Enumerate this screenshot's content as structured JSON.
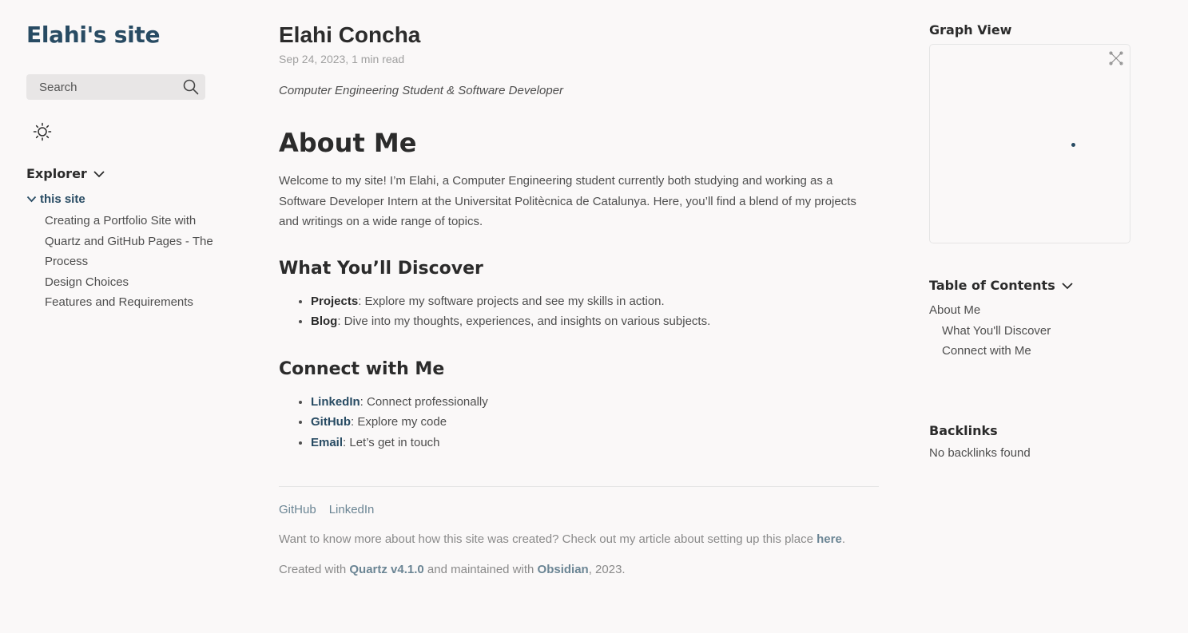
{
  "sidebar": {
    "site_title": "Elahi's site",
    "search_placeholder": "Search",
    "explorer_label": "Explorer",
    "folder_label": "this site",
    "files": [
      "Creating a Portfolio Site with Quartz and GitHub Pages - The Process",
      "Design Choices",
      "Features and Requirements"
    ]
  },
  "article": {
    "title": "Elahi Concha",
    "meta": "Sep 24, 2023, 1 min read",
    "subtitle": "Computer Engineering Student & Software Developer",
    "about_heading": "About Me",
    "about_text": "Welcome to my site! I’m Elahi, a Computer Engineering student currently both studying and working as a Software Developer Intern at the Universitat Politècnica de Catalunya. Here, you’ll find a blend of my projects and writings on a wide range of topics.",
    "discover_heading": "What You’ll Discover",
    "discover_items": [
      {
        "label": "Projects",
        "text": ": Explore my software projects and see my skills in action."
      },
      {
        "label": "Blog",
        "text": ": Dive into my thoughts, experiences, and insights on various subjects."
      }
    ],
    "connect_heading": "Connect with Me",
    "connect_items": [
      {
        "label": "LinkedIn",
        "text": ": Connect professionally"
      },
      {
        "label": "GitHub",
        "text": ": Explore my code"
      },
      {
        "label": "Email",
        "text": ": Let’s get in touch"
      }
    ]
  },
  "footer": {
    "links": [
      "GitHub",
      "LinkedIn"
    ],
    "created_prefix": "Want to know more about how this site was created? Check out my article about setting up this place ",
    "created_link": "here",
    "created_suffix": ".",
    "credit_prefix": "Created with ",
    "credit_quartz": "Quartz v4.1.0",
    "credit_mid": " and maintained with ",
    "credit_obsidian": "Obsidian",
    "credit_suffix": ", 2023."
  },
  "right": {
    "graph_heading": "Graph View",
    "toc_heading": "Table of Contents",
    "toc": [
      {
        "label": "About Me",
        "sub": false
      },
      {
        "label": "What You'll Discover",
        "sub": true
      },
      {
        "label": "Connect with Me",
        "sub": true
      }
    ],
    "backlinks_heading": "Backlinks",
    "backlinks_empty": "No backlinks found"
  },
  "colors": {
    "accent": "#284b63",
    "text": "#4e4e4e",
    "heading": "#2b2b2b",
    "muted": "#a0a0a0",
    "background": "#faf8f8"
  }
}
